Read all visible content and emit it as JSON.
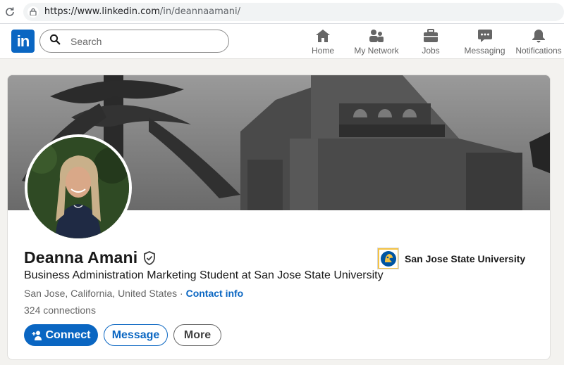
{
  "browser": {
    "url_host": "https://www.linkedin.com",
    "url_path": "/in/deannaamani/"
  },
  "nav": {
    "logo_text": "in",
    "search_placeholder": "Search",
    "items": [
      {
        "label": "Home",
        "icon": "home-icon"
      },
      {
        "label": "My Network",
        "icon": "people-icon"
      },
      {
        "label": "Jobs",
        "icon": "briefcase-icon"
      },
      {
        "label": "Messaging",
        "icon": "chat-icon"
      },
      {
        "label": "Notifications",
        "icon": "bell-icon"
      }
    ]
  },
  "profile": {
    "name": "Deanna Amani",
    "headline": "Business Administration Marketing Student at San Jose State University",
    "location": "San Jose, California, United States",
    "separator": " · ",
    "contact_label": "Contact info",
    "connections": "324 connections",
    "education": "San Jose State University"
  },
  "actions": {
    "connect": "Connect",
    "message": "Message",
    "more": "More"
  },
  "colors": {
    "brand": "#0a66c2",
    "page_bg": "#f3f2ef",
    "school_logo": "#f5c342"
  }
}
